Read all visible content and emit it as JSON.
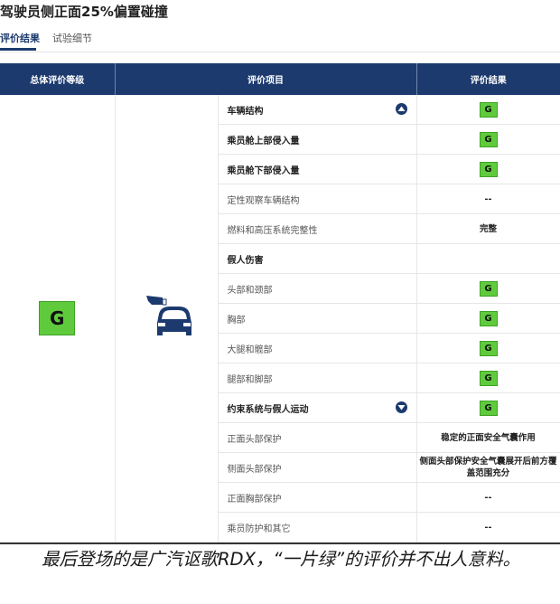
{
  "page": {
    "title": "驾驶员侧正面25%偏置碰撞",
    "tabs": [
      {
        "label": "评价结果",
        "active": true
      },
      {
        "label": "试验细节",
        "active": false
      }
    ]
  },
  "table": {
    "headers": [
      "总体评价等级",
      "评价项目",
      "评价结果"
    ],
    "overall_rating": "G",
    "icon": "car-front-offset-crash-icon",
    "rows": [
      {
        "item": "车辆结构",
        "bold": true,
        "result": "G",
        "result_type": "badge",
        "toggle": "collapse"
      },
      {
        "item": "乘员舱上部侵入量",
        "bold": true,
        "result": "G",
        "result_type": "badge"
      },
      {
        "item": "乘员舱下部侵入量",
        "bold": true,
        "result": "G",
        "result_type": "badge"
      },
      {
        "item": "定性观察车辆结构",
        "bold": false,
        "result": "--",
        "result_type": "text"
      },
      {
        "item": "燃料和高压系统完整性",
        "bold": false,
        "result": "完整",
        "result_type": "text"
      },
      {
        "item": "假人伤害",
        "bold": true,
        "result": "",
        "result_type": "none"
      },
      {
        "item": "头部和颈部",
        "bold": false,
        "result": "G",
        "result_type": "badge"
      },
      {
        "item": "胸部",
        "bold": false,
        "result": "G",
        "result_type": "badge"
      },
      {
        "item": "大腿和髋部",
        "bold": false,
        "result": "G",
        "result_type": "badge"
      },
      {
        "item": "腿部和脚部",
        "bold": false,
        "result": "G",
        "result_type": "badge"
      },
      {
        "item": "约束系统与假人运动",
        "bold": true,
        "result": "G",
        "result_type": "badge",
        "toggle": "expand"
      },
      {
        "item": "正面头部保护",
        "bold": false,
        "result": "稳定的正面安全气囊作用",
        "result_type": "text"
      },
      {
        "item": "侧面头部保护",
        "bold": false,
        "result": "侧面头部保护安全气囊展开后前方覆盖范围充分",
        "result_type": "text"
      },
      {
        "item": "正面胸部保护",
        "bold": false,
        "result": "--",
        "result_type": "text"
      },
      {
        "item": "乘员防护和其它",
        "bold": false,
        "result": "--",
        "result_type": "text"
      }
    ]
  },
  "caption": "最后登场的是广汽讴歌RDX，“一片绿”的评价并不出人意料。",
  "colors": {
    "header_bg": "#1c3a6e",
    "good_green": "#5fcb3c"
  }
}
